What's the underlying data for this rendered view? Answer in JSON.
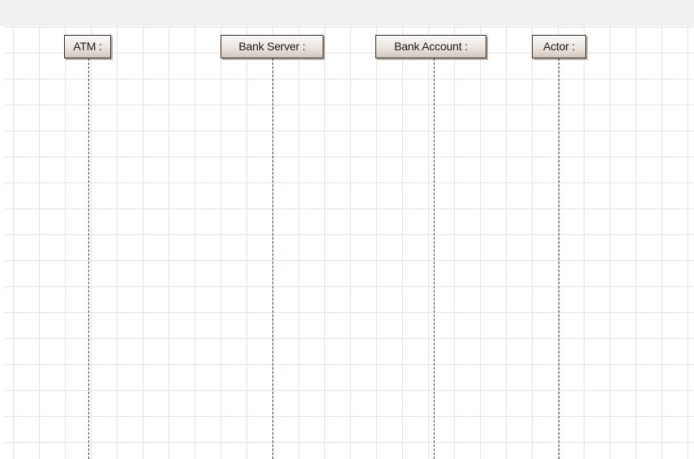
{
  "diagram": {
    "type": "sequence",
    "lifelines": [
      {
        "id": "atm",
        "label": "ATM :"
      },
      {
        "id": "bank-server",
        "label": "Bank Server :"
      },
      {
        "id": "bank-account",
        "label": "Bank Account :"
      },
      {
        "id": "actor",
        "label": "Actor :"
      }
    ],
    "colors": {
      "border": "#3c2b22",
      "head_gradient_top": "#fbf9f7",
      "head_gradient_bottom": "#d2c7bc",
      "lifeline_dash": "#5a3a2a",
      "grid": "#e3e3e3",
      "top_band": "#f0f0f0"
    }
  }
}
